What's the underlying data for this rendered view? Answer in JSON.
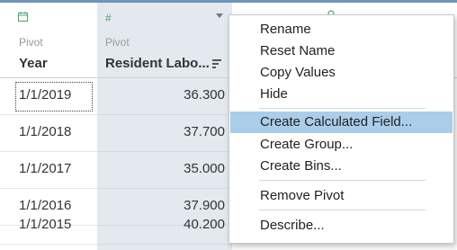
{
  "columns": {
    "year": {
      "type_icon": "calendar-icon",
      "pivot_label": "Pivot",
      "name": "Year"
    },
    "resident": {
      "type_icon": "number-icon",
      "type_symbol": "#",
      "pivot_label": "Pivot",
      "name": "Resident Labo..."
    },
    "next": {
      "type_icon": "search-icon"
    }
  },
  "rows": [
    {
      "year": "1/1/2019",
      "value": "36.300"
    },
    {
      "year": "1/1/2018",
      "value": "37.700"
    },
    {
      "year": "1/1/2017",
      "value": "35.000"
    },
    {
      "year": "1/1/2016",
      "value": "37.900"
    },
    {
      "year": "1/1/2015",
      "value": "40.200"
    }
  ],
  "context_menu": {
    "items": [
      {
        "label": "Rename"
      },
      {
        "label": "Reset Name"
      },
      {
        "label": "Copy Values"
      },
      {
        "label": "Hide"
      },
      {
        "label": "Create Calculated Field..."
      },
      {
        "label": "Create Group..."
      },
      {
        "label": "Create Bins..."
      },
      {
        "label": "Remove Pivot"
      },
      {
        "label": "Describe..."
      }
    ],
    "highlighted_item": "Create Calculated Field..."
  },
  "colors": {
    "accent_bar": "#6f96b7",
    "type_icon": "#4aa36f",
    "selected_column_bg": "#e4e9ef",
    "menu_highlight": "#aacde9"
  }
}
